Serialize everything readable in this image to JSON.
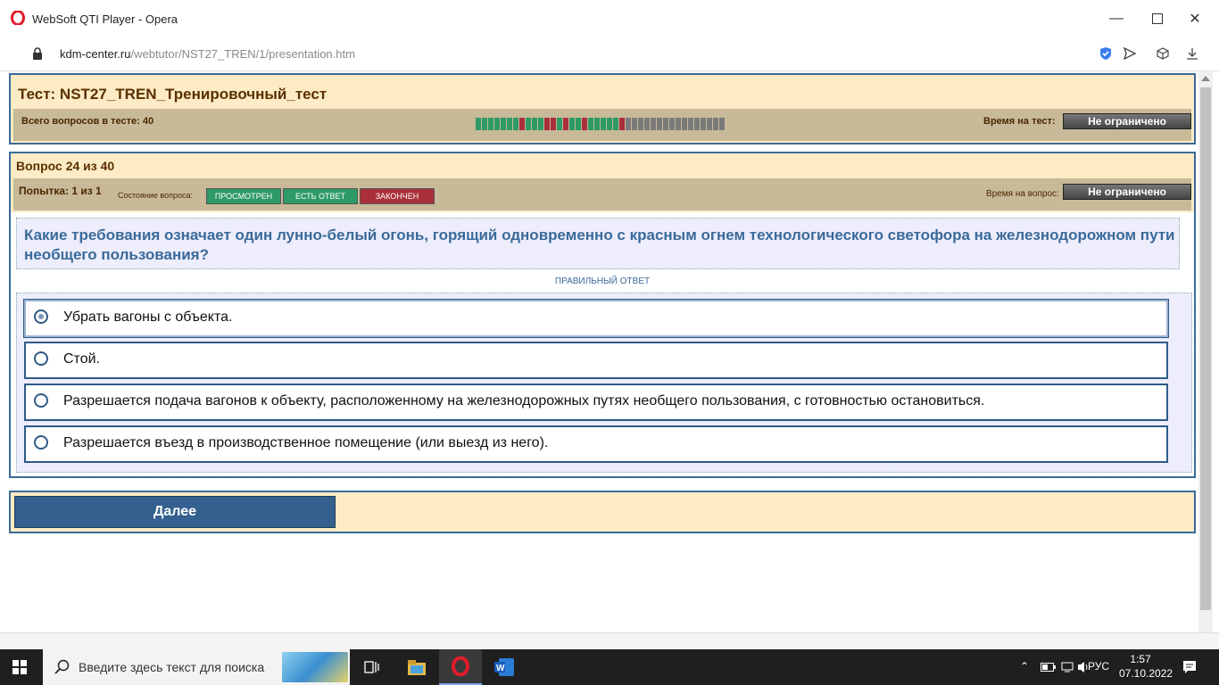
{
  "browser": {
    "window_title": "WebSoft QTI Player - Opera",
    "url_domain": "kdm-center.ru",
    "url_path": "/webtutor/NST27_TREN/1/presentation.htm"
  },
  "test": {
    "title": "Тест: NST27_TREN_Тренировочный_тест",
    "total_label": "Всего вопросов в тесте: 40",
    "time_label": "Время на тест:",
    "time_value": "Не ограничено",
    "question_map": [
      "g",
      "g",
      "g",
      "g",
      "g",
      "g",
      "g",
      "r",
      "g",
      "g",
      "g",
      "r",
      "r",
      "g",
      "r",
      "g",
      "g",
      "r",
      "g",
      "g",
      "g",
      "g",
      "g",
      "r",
      "n",
      "n",
      "n",
      "n",
      "n",
      "n",
      "n",
      "n",
      "n",
      "n",
      "n",
      "n",
      "n",
      "n",
      "n",
      "n"
    ]
  },
  "question": {
    "header": "Вопрос 24 из 40",
    "attempt": "Попытка: 1 из 1",
    "state_label": "Состояние вопроса:",
    "states": [
      {
        "label": "ПРОСМОТРЕН",
        "color": "#2e9a66"
      },
      {
        "label": "ЕСТЬ ОТВЕТ",
        "color": "#2e9a66"
      },
      {
        "label": "ЗАКОНЧЕН",
        "color": "#a9303a"
      }
    ],
    "time_label": "Время на вопрос:",
    "time_value": "Не ограничено",
    "text": "Какие требования означает один лунно-белый огонь, горящий одновременно с красным огнем технологического светофора на железнодорожном пути необщего пользования?",
    "correct_label": "ПРАВИЛЬНЫЙ ОТВЕТ",
    "answers": [
      {
        "text": "Убрать вагоны с объекта.",
        "selected": true
      },
      {
        "text": "Стой.",
        "selected": false
      },
      {
        "text": "Разрешается подача вагонов к объекту, расположенному на железнодорожных путях необщего пользования, с готовностью остановиться.",
        "selected": false
      },
      {
        "text": "Разрешается въезд в производственное помещение (или выезд из него).",
        "selected": false
      }
    ],
    "next_label": "Далее"
  },
  "taskbar": {
    "search_placeholder": "Введите здесь текст для поиска",
    "lang": "РУС",
    "time": "1:57",
    "date": "07.10.2022"
  },
  "colors": {
    "panel_bg": "#fcebc4",
    "bar_bg": "#c8b998",
    "accent_blue": "#3a6a9a",
    "green": "#2e9a66",
    "red": "#a9303a"
  }
}
